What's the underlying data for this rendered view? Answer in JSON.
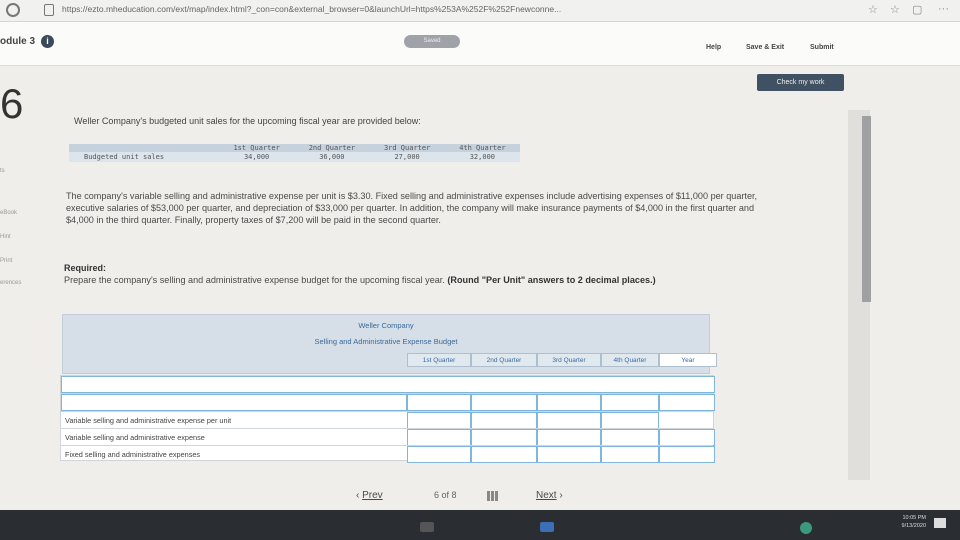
{
  "browser": {
    "url": "https://ezto.mheducation.com/ext/map/index.html?_con=con&external_browser=0&launchUrl=https%253A%252F%252Fnewconne..."
  },
  "header": {
    "module": "odule 3",
    "saved": "Saved",
    "help": "Help",
    "save_exit": "Save & Exit",
    "submit": "Submit"
  },
  "question": {
    "number": "6",
    "check_button": "Check my work",
    "tools": [
      "ts",
      "eBook",
      "Hint",
      "Print",
      "erences"
    ],
    "intro": "Weller Company's budgeted unit sales for the upcoming fiscal year are provided below:",
    "sales_table": {
      "headers": [
        "1st Quarter",
        "2nd Quarter",
        "3rd Quarter",
        "4th Quarter"
      ],
      "row_label": "Budgeted unit sales",
      "values": [
        "34,000",
        "36,000",
        "27,000",
        "32,000"
      ]
    },
    "paragraph": "The company's variable selling and administrative expense per unit is $3.30. Fixed selling and administrative expenses include advertising expenses of $11,000 per quarter, executive salaries of $53,000 per quarter, and depreciation of $33,000 per quarter. In addition, the company will make insurance payments of $4,000 in the first quarter and $4,000 in the third quarter. Finally, property taxes of $7,200 will be paid in the second quarter.",
    "required_title": "Required:",
    "required_text": "Prepare the company's selling and administrative expense budget for the upcoming fiscal year.",
    "required_bold": "(Round \"Per Unit\" answers to 2 decimal places.)"
  },
  "budget": {
    "company": "Weller Company",
    "title": "Selling and Administrative Expense Budget",
    "columns": [
      "1st Quarter",
      "2nd Quarter",
      "3rd Quarter",
      "4th Quarter",
      "Year"
    ],
    "rows": [
      "",
      "Variable selling and administrative expense per unit",
      "Variable selling and administrative expense",
      "Fixed selling and administrative expenses",
      ""
    ]
  },
  "nav": {
    "prev": "Prev",
    "page": "6",
    "of": "of 8",
    "next": "Next"
  },
  "taskbar": {
    "time": "10:05 PM",
    "date": "9/13/2020"
  }
}
